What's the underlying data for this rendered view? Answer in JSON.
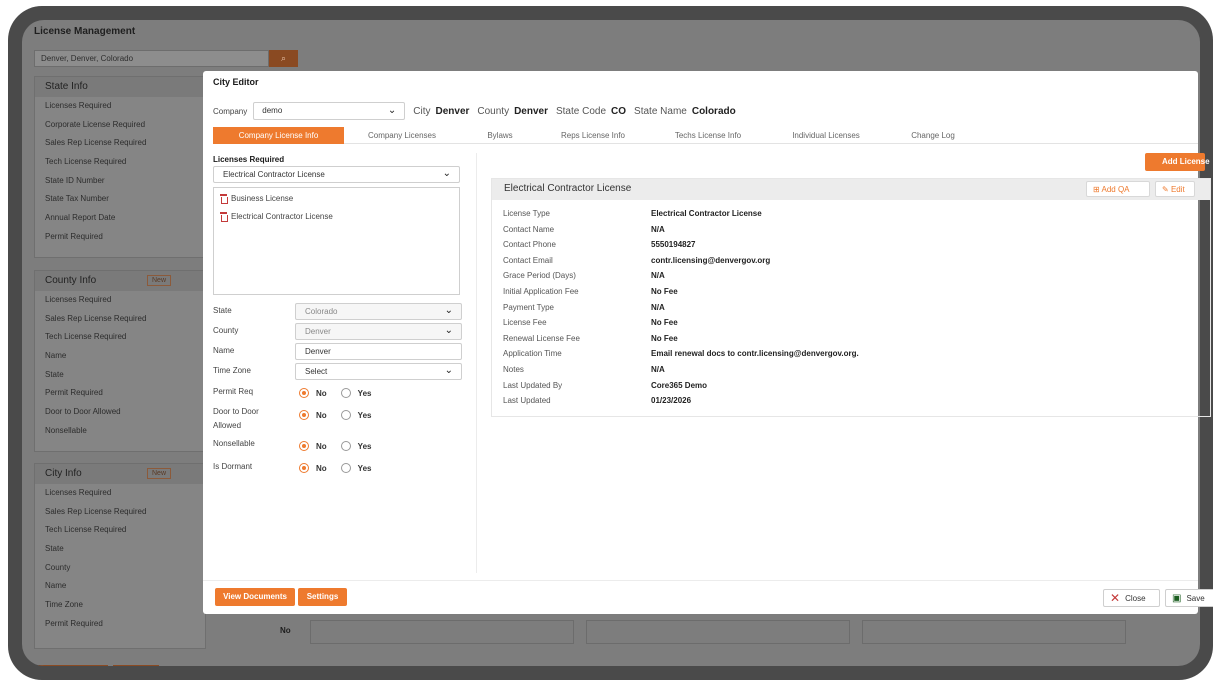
{
  "background": {
    "title": "License Management",
    "search_value": "Denver, Denver, Colorado",
    "search_icon": "search-icon",
    "state_panel": {
      "title": "State Info",
      "rows": [
        "Licenses Required",
        "Corporate License Required",
        "Sales Rep License Required",
        "Tech License Required",
        "State ID Number",
        "State Tax Number",
        "Annual Report Date",
        "Permit Required"
      ]
    },
    "county_panel": {
      "title": "County Info",
      "new_label": "New",
      "rows": [
        "Licenses Required",
        "Sales Rep License Required",
        "Tech License Required",
        "Name",
        "State",
        "Permit Required",
        "Door to Door Allowed",
        "Nonsellable"
      ]
    },
    "city_panel": {
      "title": "City Info",
      "new_label": "New",
      "rows": [
        "Licenses Required",
        "Sales Rep License Required",
        "Tech License Required",
        "State",
        "County",
        "Name",
        "Time Zone",
        "Permit Required"
      ]
    },
    "permit_value": "No"
  },
  "modal": {
    "title": "City Editor",
    "company_label": "Company",
    "company_value": "demo",
    "city_label": "City",
    "city_value": "Denver",
    "county_label": "County",
    "county_value": "Denver",
    "state_code_label": "State Code",
    "state_code_value": "CO",
    "state_name_label": "State Name",
    "state_name_value": "Colorado",
    "tabs": [
      "Company License Info",
      "Company Licenses",
      "Bylaws",
      "Reps License Info",
      "Techs License Info",
      "Individual Licenses",
      "Change Log"
    ],
    "licenses_required": {
      "label": "Licenses Required",
      "selected": "Electrical Contractor License",
      "items": [
        "Business License",
        "Electrical Contractor License"
      ]
    },
    "fields": {
      "state_label": "State",
      "state_value": "Colorado",
      "county_label": "County",
      "county_value": "Denver",
      "name_label": "Name",
      "name_value": "Denver",
      "timezone_label": "Time Zone",
      "timezone_value": "Select",
      "permit_label": "Permit Req",
      "door_label_1": "Door to Door",
      "door_label_2": "Allowed",
      "nonsellable_label": "Nonsellable",
      "dormant_label": "Is Dormant",
      "no": "No",
      "yes": "Yes"
    },
    "add_button": "Add License",
    "card": {
      "title": "Electrical Contractor License",
      "add_qa": "Add QA",
      "edit": "Edit",
      "rows": [
        {
          "label": "License Type",
          "value": "Electrical Contractor License"
        },
        {
          "label": "Contact Name",
          "value": "N/A"
        },
        {
          "label": "Contact Phone",
          "value": "5550194827"
        },
        {
          "label": "Contact Email",
          "value": "contr.licensing@denvergov.org"
        },
        {
          "label": "Grace Period (Days)",
          "value": "N/A"
        },
        {
          "label": "Initial Application Fee",
          "value": "No Fee"
        },
        {
          "label": "Payment Type",
          "value": "N/A"
        },
        {
          "label": "License Fee",
          "value": "No Fee"
        },
        {
          "label": "Renewal License Fee",
          "value": "No Fee"
        },
        {
          "label": "Application Time",
          "value": "Email renewal docs to contr.licensing@denvergov.org."
        },
        {
          "label": "Notes",
          "value": "N/A"
        },
        {
          "label": "Last Updated By",
          "value": "Core365 Demo"
        },
        {
          "label": "Last Updated",
          "value": "01/23/2026"
        }
      ]
    },
    "footer": {
      "view_documents": "View Documents",
      "settings": "Settings",
      "close": "Close",
      "save": "Save"
    }
  },
  "colors": {
    "accent": "#ee7a2e",
    "danger": "#c43a3a"
  }
}
